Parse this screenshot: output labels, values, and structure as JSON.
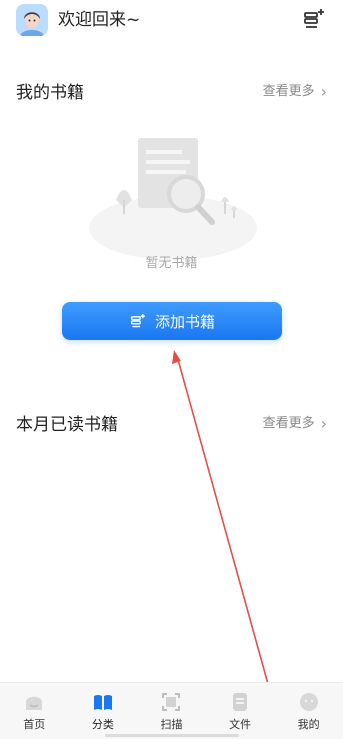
{
  "header": {
    "welcome": "欢迎回来~",
    "avatar_icon": "avatar",
    "add_book_icon": "add-book-icon"
  },
  "my_books": {
    "title": "我的书籍",
    "more": "查看更多",
    "empty_text": "暂无书籍",
    "add_button": "添加书籍"
  },
  "monthly_read": {
    "title": "本月已读书籍",
    "more": "查看更多"
  },
  "bottom_nav": [
    {
      "label": "首页",
      "icon": "home-icon"
    },
    {
      "label": "分类",
      "icon": "category-icon"
    },
    {
      "label": "扫描",
      "icon": "scan-icon"
    },
    {
      "label": "文件",
      "icon": "file-icon"
    },
    {
      "label": "我的",
      "icon": "profile-icon"
    }
  ],
  "colors": {
    "accent": "#1a77f0",
    "annotation": "#e0504a"
  }
}
